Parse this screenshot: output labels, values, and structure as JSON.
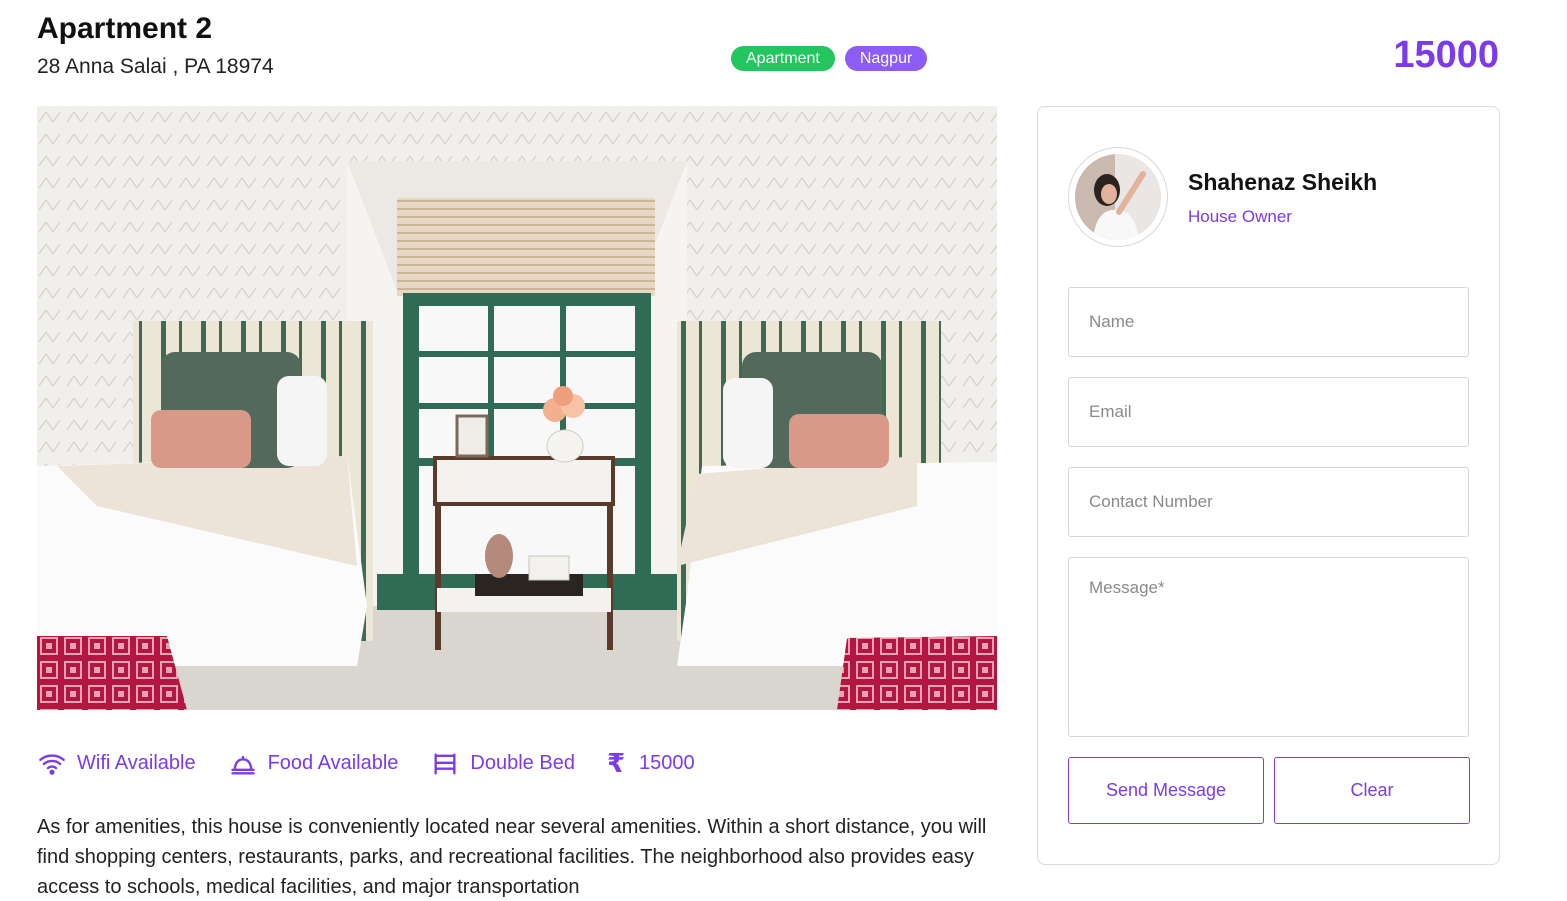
{
  "listing": {
    "title": "Apartment 2",
    "address": "28 Anna Salai , PA 18974",
    "badges": {
      "type": "Apartment",
      "city": "Nagpur"
    },
    "price": "15000"
  },
  "amenities": [
    {
      "icon": "wifi-icon",
      "label": "Wifi Available"
    },
    {
      "icon": "food-icon",
      "label": "Food Available"
    },
    {
      "icon": "bed-icon",
      "label": "Double Bed"
    },
    {
      "icon": "rupee-icon",
      "symbol": "₹",
      "label": "15000"
    }
  ],
  "description": "As for amenities, this house is conveniently located near several amenities. Within a short distance, you will find shopping centers, restaurants, parks, and recreational facilities. The neighborhood also provides easy access to schools, medical facilities, and major transportation",
  "owner": {
    "name": "Shahenaz Sheikh",
    "role": "House Owner"
  },
  "form": {
    "name_placeholder": "Name",
    "email_placeholder": "Email",
    "contact_placeholder": "Contact Number",
    "message_placeholder": "Message*",
    "send_label": "Send Message",
    "clear_label": "Clear"
  },
  "colors": {
    "accent": "#7c3aed",
    "badge_type": "#22c55e",
    "badge_city": "#8b5cf6"
  }
}
